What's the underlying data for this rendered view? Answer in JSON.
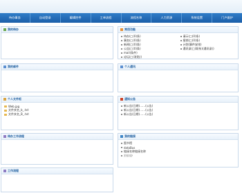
{
  "nav": [
    "待办事务",
    "自动登录",
    "编辑控件",
    "工单流程",
    "流程名称",
    "人力资源",
    "系统设置",
    "门户维护"
  ],
  "panels": {
    "top_left": {
      "title": "我的待办"
    },
    "top_right": {
      "title": "常用功能",
      "items": [
        "待办(□(0)条)",
        "事务(□(0)条)",
        "新闻(□(0)条)",
        "公告(□(0)条)",
        "mail(条件)",
        "论坛(□(发贴))"
      ],
      "items_right": [
        "请示(□(0)条)",
        "报销(□(0)条)",
        "计划(事件安排)",
        "通讯录(□(联系)(通讯录))"
      ]
    },
    "mid_left": {
      "title": "我的邮件"
    },
    "mid_right": {
      "title": "个人通讯"
    },
    "files": {
      "title": "个人文件柜",
      "items": [
        "Web.jpg",
        "文件夹名_b_.txt",
        "文件夹名_B_.txt"
      ]
    },
    "notice": {
      "title": "通知公告",
      "items": [
        "新公告(日期)……(公告)",
        "新公告(日期)……(公告)",
        "新公告(日期)……(公告)"
      ]
    },
    "tasks": {
      "title": "待办工作流程"
    },
    "links": {
      "title": "我的链接",
      "items": [
        "图书馆",
        "dataBus",
        "链接名称链接名称",
        "??????"
      ]
    },
    "bottom_left": {
      "title": "工作流程"
    }
  },
  "colors": {
    "nav_bg": "#1c5fa8",
    "title": "#1f5fa0",
    "border": "#c9d9ea"
  }
}
